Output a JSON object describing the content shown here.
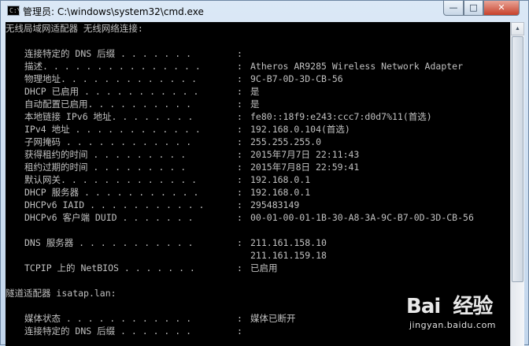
{
  "window": {
    "title": "管理员: C:\\windows\\system32\\cmd.exe",
    "app_icon_text": "C:\\",
    "buttons": {
      "minimize": "—",
      "maximize": "□",
      "close": "✕"
    }
  },
  "console": {
    "lines": [
      {
        "type": "header",
        "text": "无线局域网适配器 无线网络连接:"
      },
      {
        "type": "blank"
      },
      {
        "type": "kv",
        "key": "连接特定的 DNS 后缀 . . . . . . .",
        "value": ""
      },
      {
        "type": "kv",
        "key": "描述. . . . . . . . . . . . . . .",
        "value": "Atheros AR9285 Wireless Network Adapter"
      },
      {
        "type": "kv",
        "key": "物理地址. . . . . . . . . . . . .",
        "value": "9C-B7-0D-3D-CB-56"
      },
      {
        "type": "kv",
        "key": "DHCP 已启用 . . . . . . . . . . .",
        "value": "是"
      },
      {
        "type": "kv",
        "key": "自动配置已启用. . . . . . . . . .",
        "value": "是"
      },
      {
        "type": "kv",
        "key": "本地链接 IPv6 地址. . . . . . . .",
        "value": "fe80::18f9:e243:ccc7:d0d7%11(首选)"
      },
      {
        "type": "kv",
        "key": "IPv4 地址 . . . . . . . . . . . .",
        "value": "192.168.0.104(首选)"
      },
      {
        "type": "kv",
        "key": "子网掩码 . . . . . . . . . . . .",
        "value": "255.255.255.0"
      },
      {
        "type": "kv",
        "key": "获得租约的时间 . . . . . . . . .",
        "value": "2015年7月7日 22:11:43"
      },
      {
        "type": "kv",
        "key": "租约过期的时间 . . . . . . . . .",
        "value": "2015年7月8日 22:59:41"
      },
      {
        "type": "kv",
        "key": "默认网关. . . . . . . . . . . . .",
        "value": "192.168.0.1"
      },
      {
        "type": "kv",
        "key": "DHCP 服务器 . . . . . . . . . . .",
        "value": "192.168.0.1"
      },
      {
        "type": "kv",
        "key": "DHCPv6 IAID . . . . . . . . . . .",
        "value": "295483149"
      },
      {
        "type": "kv",
        "key": "DHCPv6 客户端 DUID . . . . . . .",
        "value": "00-01-00-01-1B-30-A8-3A-9C-B7-0D-3D-CB-56"
      },
      {
        "type": "blank"
      },
      {
        "type": "kv",
        "key": "DNS 服务器 . . . . . . . . . . .",
        "value": "211.161.158.10"
      },
      {
        "type": "cont",
        "value": "211.161.159.18"
      },
      {
        "type": "kv",
        "key": "TCPIP 上的 NetBIOS . . . . . . .",
        "value": "已启用"
      },
      {
        "type": "blank"
      },
      {
        "type": "header",
        "text": "隧道适配器 isatap.lan:"
      },
      {
        "type": "blank"
      },
      {
        "type": "kv",
        "key": "媒体状态 . . . . . . . . . . . .",
        "value": "媒体已断开"
      },
      {
        "type": "kv",
        "key": "连接特定的 DNS 后缀 . . . . . . .",
        "value": ""
      }
    ]
  },
  "watermark": {
    "brand": "Bai  经验",
    "url": "jingyan.baidu.com"
  }
}
